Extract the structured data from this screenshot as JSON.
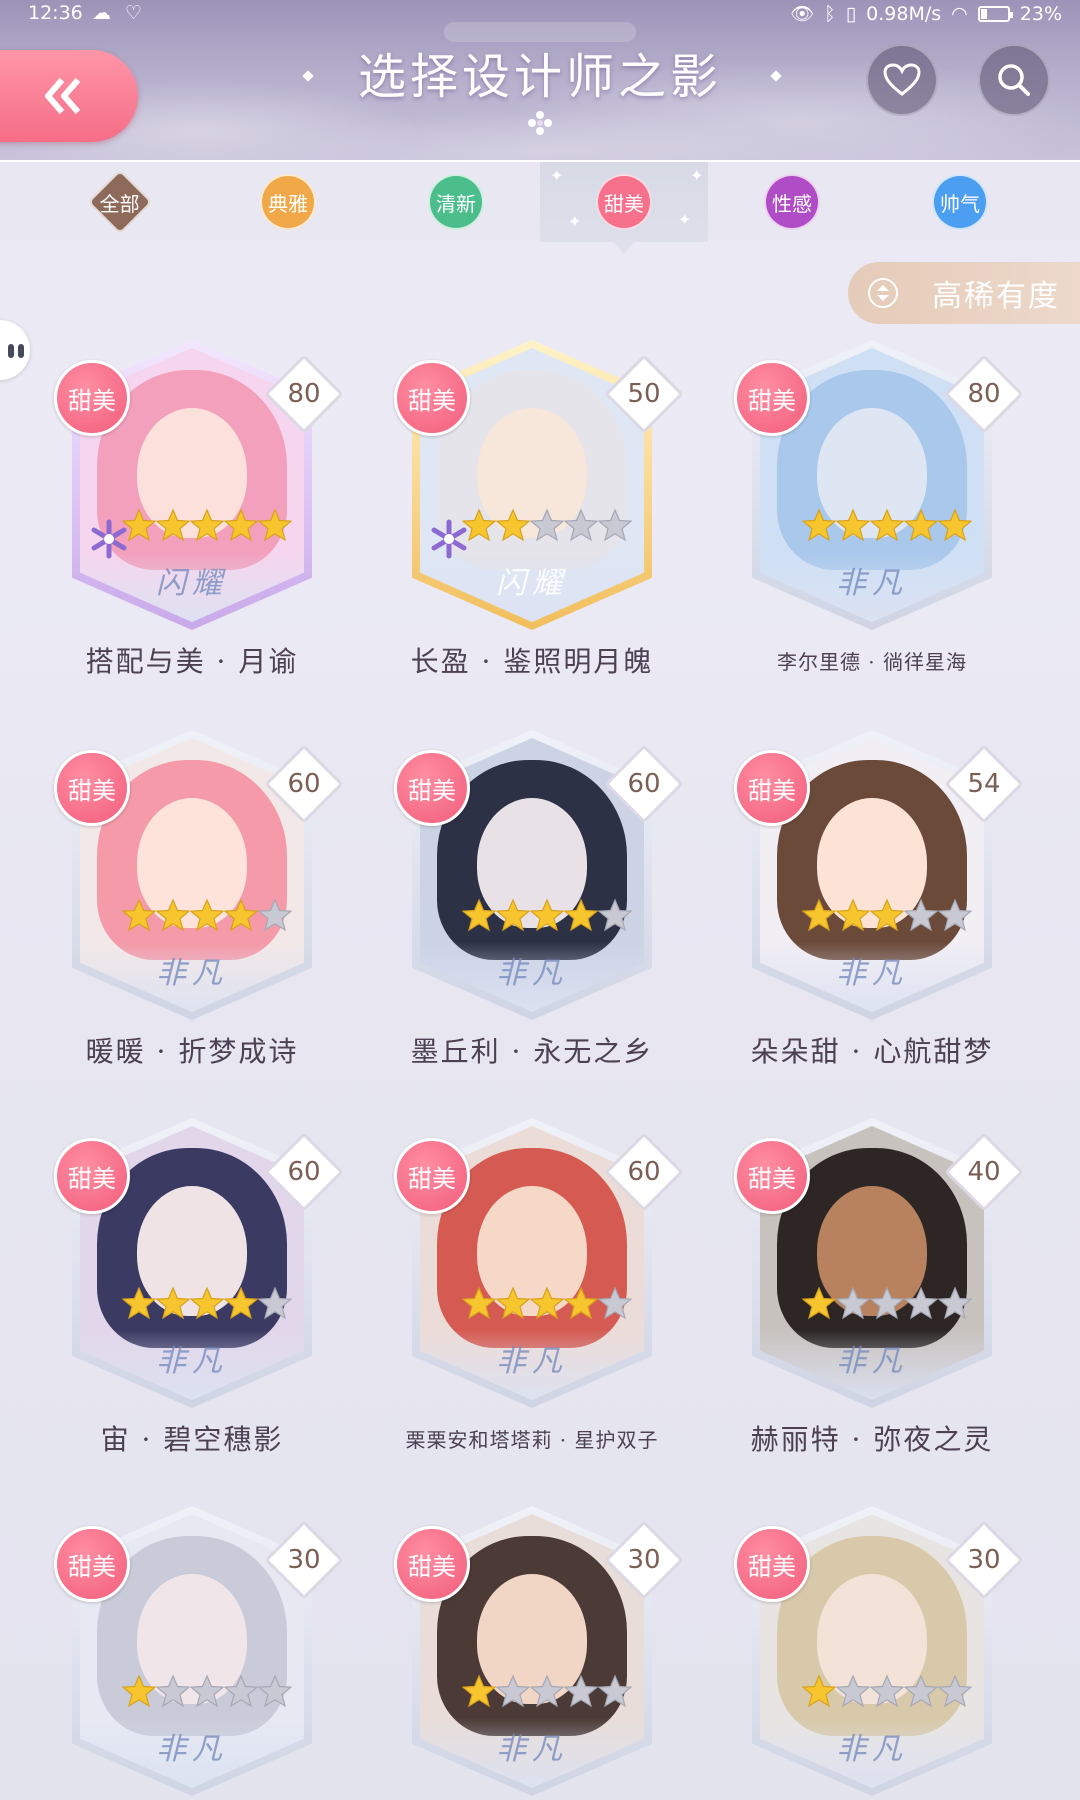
{
  "status_bar": {
    "time": "12:36",
    "network_speed": "0.98M/s",
    "battery": "23%",
    "battery_level": 0.23
  },
  "header": {
    "title": "选择设计师之影",
    "back_icon": "double-chevron-left-icon",
    "favorites_icon": "heart-icon",
    "search_icon": "search-icon"
  },
  "tabs": [
    {
      "label": "全部",
      "color": "#8d6a5a",
      "shape": "diamond",
      "active": false
    },
    {
      "label": "典雅",
      "color": "#f0a848",
      "shape": "circle",
      "active": false
    },
    {
      "label": "清新",
      "color": "#4cbe8c",
      "shape": "circle",
      "active": false
    },
    {
      "label": "甜美",
      "color": "#f7708c",
      "shape": "circle",
      "active": true
    },
    {
      "label": "性感",
      "color": "#b04cc6",
      "shape": "circle",
      "active": false
    },
    {
      "label": "帅气",
      "color": "#4c9ef0",
      "shape": "circle",
      "active": false
    }
  ],
  "sort": {
    "label": "高稀有度",
    "icon": "sort-arrows-icon"
  },
  "cards": [
    {
      "name": "搭配与美 · 月谕",
      "category": "甜美",
      "level": "80",
      "stars": 5,
      "rank_text": "闪耀",
      "frame": "violet",
      "snowflake": true,
      "hair": "#f3a0bc",
      "skin": "#fbe0dc",
      "bg": "#f6d6ee"
    },
    {
      "name": "长盈 · 鉴照明月魄",
      "category": "甜美",
      "level": "50",
      "stars": 2,
      "rank_text": "闪耀",
      "frame": "gold",
      "snowflake": true,
      "hair": "#e4e4ea",
      "skin": "#f7e6da",
      "bg": "#dfe6f4"
    },
    {
      "name": "李尔里德 · 徜徉星海",
      "category": "甜美",
      "level": "80",
      "stars": 5,
      "rank_text": "非凡",
      "frame": "silver",
      "snowflake": false,
      "hair": "#a9c8ec",
      "skin": "#dfe6f3",
      "bg": "#cfe0f5"
    },
    {
      "name": "暖暖 · 折梦成诗",
      "category": "甜美",
      "level": "60",
      "stars": 4,
      "rank_text": "非凡",
      "frame": "silver",
      "snowflake": false,
      "hair": "#f49aa8",
      "skin": "#fde3da",
      "bg": "#f2e8e8"
    },
    {
      "name": "墨丘利 · 永无之乡",
      "category": "甜美",
      "level": "60",
      "stars": 4,
      "rank_text": "非凡",
      "frame": "silver",
      "snowflake": false,
      "hair": "#2c3146",
      "skin": "#e8e2e6",
      "bg": "#cbd3e4"
    },
    {
      "name": "朵朵甜 · 心航甜梦",
      "category": "甜美",
      "level": "54",
      "stars": 3,
      "rank_text": "非凡",
      "frame": "silver",
      "snowflake": false,
      "hair": "#6b4a3a",
      "skin": "#fde3d6",
      "bg": "#f1eef4"
    },
    {
      "name": "宙 · 碧空穗影",
      "category": "甜美",
      "level": "60",
      "stars": 4,
      "rank_text": "非凡",
      "frame": "silver",
      "snowflake": false,
      "hair": "#3b3a63",
      "skin": "#efe3e6",
      "bg": "#e2d6ea"
    },
    {
      "name": "栗栗安和塔塔莉 · 星护双子",
      "category": "甜美",
      "level": "60",
      "stars": 4,
      "rank_text": "非凡",
      "frame": "silver",
      "snowflake": false,
      "hair": "#d55b52",
      "skin": "#f6d8c8",
      "bg": "#ecdcd8"
    },
    {
      "name": "赫丽特 · 弥夜之灵",
      "category": "甜美",
      "level": "40",
      "stars": 1,
      "rank_text": "非凡",
      "frame": "silver",
      "snowflake": false,
      "hair": "#2d2625",
      "skin": "#b8825e",
      "bg": "#c8c2be"
    },
    {
      "name": "",
      "category": "甜美",
      "level": "30",
      "stars": 1,
      "rank_text": "非凡",
      "frame": "silver",
      "snowflake": false,
      "hair": "#c9cbd8",
      "skin": "#f0e6ea",
      "bg": "#e6e9f2"
    },
    {
      "name": "",
      "category": "甜美",
      "level": "30",
      "stars": 1,
      "rank_text": "非凡",
      "frame": "silver",
      "snowflake": false,
      "hair": "#4b3a36",
      "skin": "#f1d6c6",
      "bg": "#e8ddd8"
    },
    {
      "name": "",
      "category": "甜美",
      "level": "30",
      "stars": 1,
      "rank_text": "非凡",
      "frame": "silver",
      "snowflake": false,
      "hair": "#d8c9aa",
      "skin": "#f3e2d8",
      "bg": "#e8e4e2"
    }
  ]
}
